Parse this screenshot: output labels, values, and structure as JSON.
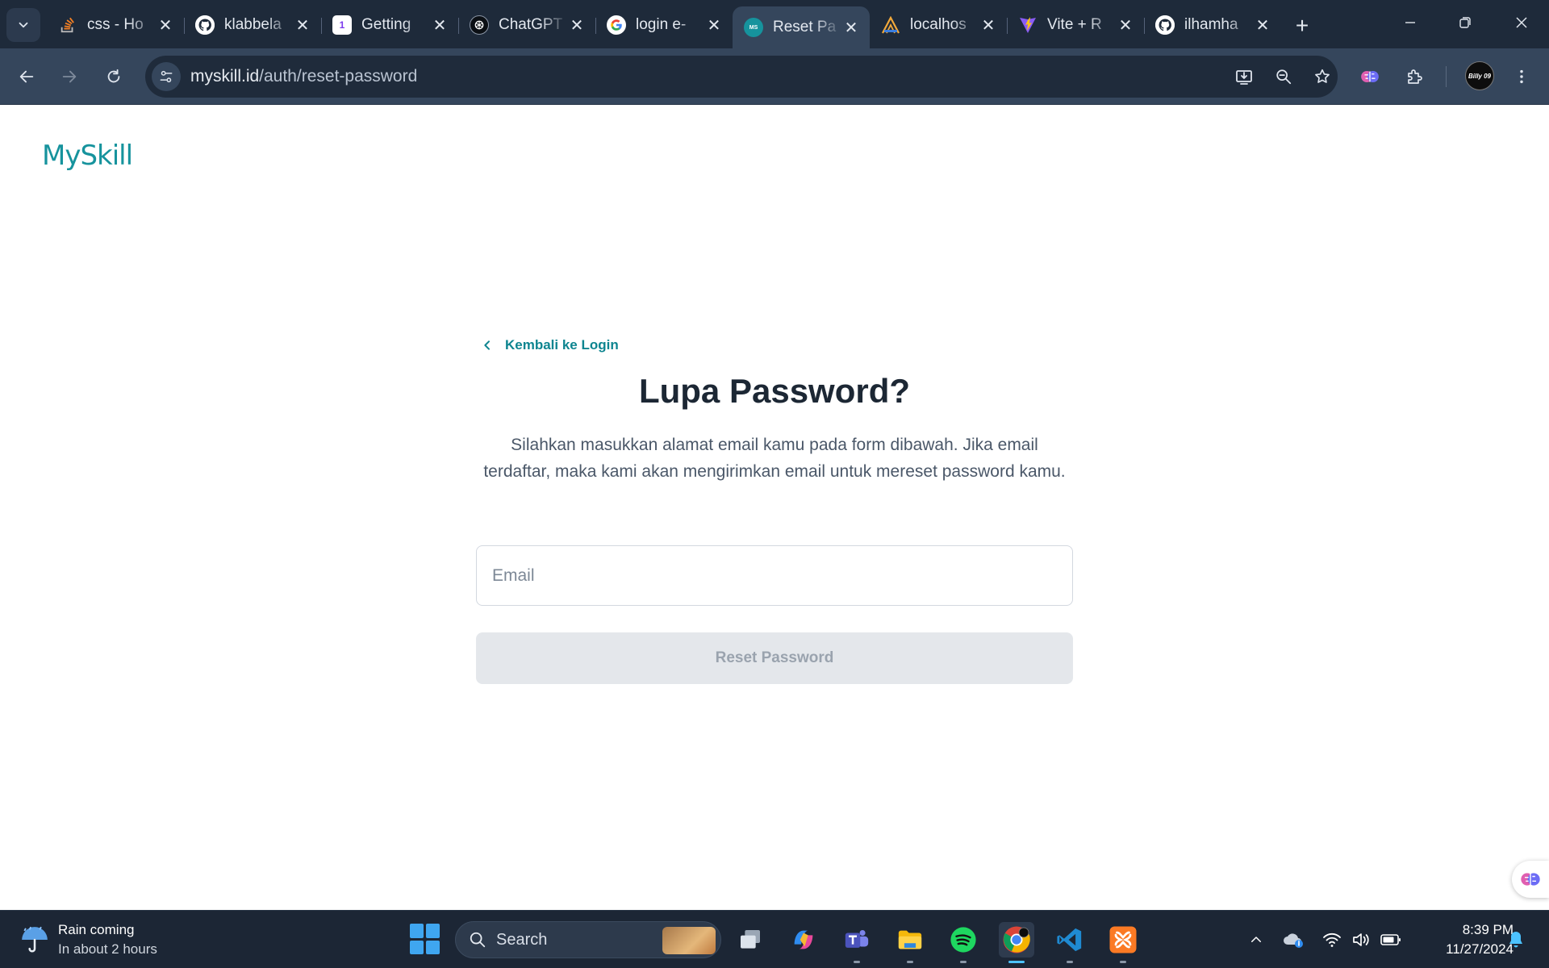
{
  "browser": {
    "tabs": [
      {
        "title": "css - Ho",
        "icon": "stackoverflow-icon",
        "active": false
      },
      {
        "title": "klabbela",
        "icon": "github-icon",
        "active": false
      },
      {
        "title": "Getting",
        "icon": "app-icon",
        "active": false
      },
      {
        "title": "ChatGPT",
        "icon": "chatgpt-icon",
        "active": false
      },
      {
        "title": "login e-",
        "icon": "google-icon",
        "active": false
      },
      {
        "title": "Reset Pa",
        "icon": "myskill-icon",
        "active": true
      },
      {
        "title": "localhos",
        "icon": "localhost-icon",
        "active": false
      },
      {
        "title": "Vite + R",
        "icon": "vite-icon",
        "active": false
      },
      {
        "title": "ilhamha",
        "icon": "github-icon",
        "active": false
      }
    ],
    "url": {
      "domain": "myskill.id",
      "path": "/auth/reset-password"
    },
    "profile_label": "Billy 09"
  },
  "page": {
    "logo": "MySkill",
    "back_link": "Kembali ke Login",
    "title": "Lupa Password?",
    "description": "Silahkan masukkan alamat email kamu pada form dibawah. Jika email terdaftar, maka kami akan mengirimkan email untuk mereset password kamu.",
    "email_placeholder": "Email",
    "email_value": "",
    "submit_label": "Reset Password",
    "colors": {
      "brand": "#16939d",
      "link": "#0e8590",
      "button_disabled": "#e4e7eb"
    }
  },
  "taskbar": {
    "weather_title": "Rain coming",
    "weather_sub": "In about 2 hours",
    "search_label": "Search",
    "time": "8:39 PM",
    "date": "11/27/2024"
  }
}
